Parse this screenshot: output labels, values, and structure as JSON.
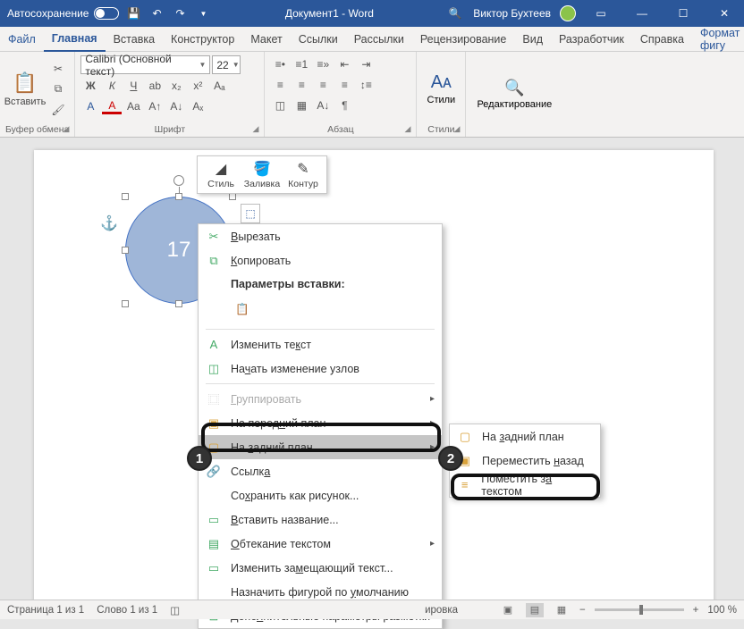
{
  "titlebar": {
    "autosave": "Автосохранение",
    "doc_title": "Документ1 - Word",
    "user": "Виктор Бухтеев"
  },
  "tabs": {
    "file": "Файл",
    "home": "Главная",
    "insert": "Вставка",
    "design": "Конструктор",
    "layout": "Макет",
    "references": "Ссылки",
    "mailings": "Рассылки",
    "review": "Рецензирование",
    "view": "Вид",
    "developer": "Разработчик",
    "help": "Справка",
    "format": "Формат фигу"
  },
  "ribbon": {
    "clipboard": {
      "paste": "Вставить",
      "group": "Буфер обмена"
    },
    "font": {
      "name": "Calibri (Основной текст)",
      "size": "22",
      "group": "Шрифт"
    },
    "para": {
      "group": "Абзац"
    },
    "styles": {
      "label": "Стили",
      "group": "Стили"
    },
    "editing": {
      "label": "Редактирование"
    }
  },
  "shape": {
    "text": "17"
  },
  "minitoolbar": {
    "style": "Стиль",
    "fill": "Заливка",
    "outline": "Контур"
  },
  "ctx": {
    "cut": "Вырезать",
    "copy": "Копировать",
    "paste_header": "Параметры вставки:",
    "edit_text": "Изменить текст",
    "edit_points": "Начать изменение узлов",
    "group": "Группировать",
    "bring_front": "На передний план",
    "send_back": "На задний план",
    "link": "Ссылка",
    "save_pic": "Сохранить как рисунок...",
    "caption": "Вставить название...",
    "wrap": "Обтекание текстом",
    "alt_text": "Изменить замещающий текст...",
    "default_shape": "Назначить фигурой по умолчанию",
    "more_layout": "Дополнительные параметры разметки"
  },
  "sub": {
    "send_back": "На задний план",
    "send_backward": "Переместить назад",
    "behind_text": "Поместить за текстом"
  },
  "markers": {
    "one": "1",
    "two": "2"
  },
  "status": {
    "page": "Страница 1 из 1",
    "words": "Слово 1 из 1",
    "partial": "ировка",
    "zoom": "100 %"
  }
}
